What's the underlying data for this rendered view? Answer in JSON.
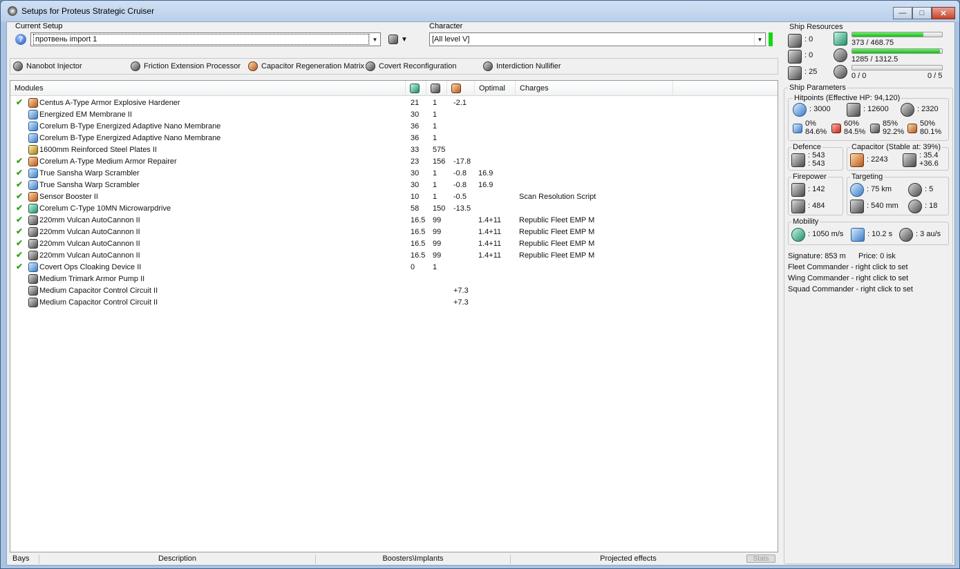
{
  "window": {
    "title": "Setups for Proteus Strategic Cruiser"
  },
  "setup": {
    "label": "Current Setup",
    "value": "протвень import 1",
    "character_label": "Character",
    "character_value": "[All level V]"
  },
  "subsystems": [
    {
      "name": "Nanobot Injector",
      "icon": "nanobot-icon"
    },
    {
      "name": "Friction Extension Processor",
      "icon": "friction-icon"
    },
    {
      "name": "Capacitor Regeneration Matrix",
      "icon": "capacitor-matrix-icon"
    },
    {
      "name": "Covert Reconfiguration",
      "icon": "covert-icon"
    },
    {
      "name": "Interdiction Nullifier",
      "icon": "nullifier-icon"
    }
  ],
  "modules": {
    "headers": {
      "name": "Modules",
      "optimal": "Optimal",
      "charges": "Charges"
    },
    "rows": [
      {
        "active": true,
        "name": "Centus A-Type Armor Explosive Hardener",
        "cpu": "21",
        "pg": "1",
        "cap": "-2.1",
        "optimal": "",
        "charge": ""
      },
      {
        "active": false,
        "name": "Energized EM Membrane II",
        "cpu": "30",
        "pg": "1",
        "cap": "",
        "optimal": "",
        "charge": ""
      },
      {
        "active": false,
        "name": "Corelum B-Type Energized Adaptive Nano Membrane",
        "cpu": "36",
        "pg": "1",
        "cap": "",
        "optimal": "",
        "charge": ""
      },
      {
        "active": false,
        "name": "Corelum B-Type Energized Adaptive Nano Membrane",
        "cpu": "36",
        "pg": "1",
        "cap": "",
        "optimal": "",
        "charge": ""
      },
      {
        "active": false,
        "name": "1600mm Reinforced Steel Plates II",
        "cpu": "33",
        "pg": "575",
        "cap": "",
        "optimal": "",
        "charge": ""
      },
      {
        "active": true,
        "name": "Corelum A-Type Medium Armor Repairer",
        "cpu": "23",
        "pg": "156",
        "cap": "-17.8",
        "optimal": "",
        "charge": ""
      },
      {
        "active": true,
        "name": "True Sansha Warp Scrambler",
        "cpu": "30",
        "pg": "1",
        "cap": "-0.8",
        "optimal": "16.9",
        "charge": ""
      },
      {
        "active": true,
        "name": "True Sansha Warp Scrambler",
        "cpu": "30",
        "pg": "1",
        "cap": "-0.8",
        "optimal": "16.9",
        "charge": ""
      },
      {
        "active": true,
        "name": "Sensor Booster II",
        "cpu": "10",
        "pg": "1",
        "cap": "-0.5",
        "optimal": "",
        "charge": "Scan Resolution Script"
      },
      {
        "active": true,
        "name": "Corelum C-Type 10MN Microwarpdrive",
        "cpu": "58",
        "pg": "150",
        "cap": "-13.5",
        "optimal": "",
        "charge": ""
      },
      {
        "active": true,
        "name": "220mm Vulcan AutoCannon II",
        "cpu": "16.5",
        "pg": "99",
        "cap": "",
        "optimal": "1.4+11",
        "charge": "Republic Fleet EMP M"
      },
      {
        "active": true,
        "name": "220mm Vulcan AutoCannon II",
        "cpu": "16.5",
        "pg": "99",
        "cap": "",
        "optimal": "1.4+11",
        "charge": "Republic Fleet EMP M"
      },
      {
        "active": true,
        "name": "220mm Vulcan AutoCannon II",
        "cpu": "16.5",
        "pg": "99",
        "cap": "",
        "optimal": "1.4+11",
        "charge": "Republic Fleet EMP M"
      },
      {
        "active": true,
        "name": "220mm Vulcan AutoCannon II",
        "cpu": "16.5",
        "pg": "99",
        "cap": "",
        "optimal": "1.4+11",
        "charge": "Republic Fleet EMP M"
      },
      {
        "active": true,
        "name": "Covert Ops Cloaking Device II",
        "cpu": "0",
        "pg": "1",
        "cap": "",
        "optimal": "",
        "charge": ""
      },
      {
        "active": false,
        "name": "Medium Trimark Armor Pump II",
        "cpu": "",
        "pg": "",
        "cap": "",
        "optimal": "",
        "charge": ""
      },
      {
        "active": false,
        "name": "Medium Capacitor Control Circuit II",
        "cpu": "",
        "pg": "",
        "cap": "+7.3",
        "optimal": "",
        "charge": ""
      },
      {
        "active": false,
        "name": "Medium Capacitor Control Circuit II",
        "cpu": "",
        "pg": "",
        "cap": "+7.3",
        "optimal": "",
        "charge": ""
      }
    ]
  },
  "bottom_tabs": {
    "bays": "Bays",
    "description": "Description",
    "boosters": "Boosters\\Implants",
    "projected": "Projected effects",
    "stats": "Stats"
  },
  "resources": {
    "title": "Ship Resources",
    "turrets": ": 0",
    "launchers": ": 0",
    "drones": ": 25",
    "cpu": "373 / 468.75",
    "cpu_fraction": 0.796,
    "powergrid": "1285 / 1312.5",
    "powergrid_fraction": 0.979,
    "drone_bay": "0 / 0",
    "drone_bay_fraction": 0,
    "drone_count": "0 / 5"
  },
  "params": {
    "title": "Ship Parameters",
    "hitpoints_title": "Hitpoints (Effective HP: 94,120)",
    "shield_hp": ": 3000",
    "armor_hp": ": 12600",
    "structure_hp": ": 2320",
    "resists": [
      {
        "a": "0%",
        "b": "84.6%",
        "icon": "em-resist-icon"
      },
      {
        "a": "60%",
        "b": "84.5%",
        "icon": "thermal-resist-icon"
      },
      {
        "a": "85%",
        "b": "92.2%",
        "icon": "kinetic-resist-icon"
      },
      {
        "a": "50%",
        "b": "80.1%",
        "icon": "explosive-resist-icon"
      }
    ],
    "defence_title": "Defence",
    "defence_a": ": 543",
    "defence_b": ": 543",
    "capacitor_title": "Capacitor (Stable at: 39%)",
    "capacitor_amount": ": 2243",
    "capacitor_a": ": 35.4",
    "capacitor_b": "+36.6",
    "firepower_title": "Firepower",
    "firepower_a": ": 142",
    "firepower_b": ": 484",
    "targeting_title": "Targeting",
    "targeting_range": ": 75 km",
    "targeting_max": ": 5",
    "targeting_res": ": 540 mm",
    "targeting_sensor": ": 18",
    "mobility_title": "Mobility",
    "speed": ": 1050 m/s",
    "align": ": 10.2 s",
    "warp": ": 3 au/s",
    "signature": "Signature: 853 m",
    "price": "Price: 0 isk",
    "fleet_commander": "Fleet Commander - right click to set",
    "wing_commander": "Wing Commander - right click to set",
    "squad_commander": "Squad Commander - right click to set"
  }
}
